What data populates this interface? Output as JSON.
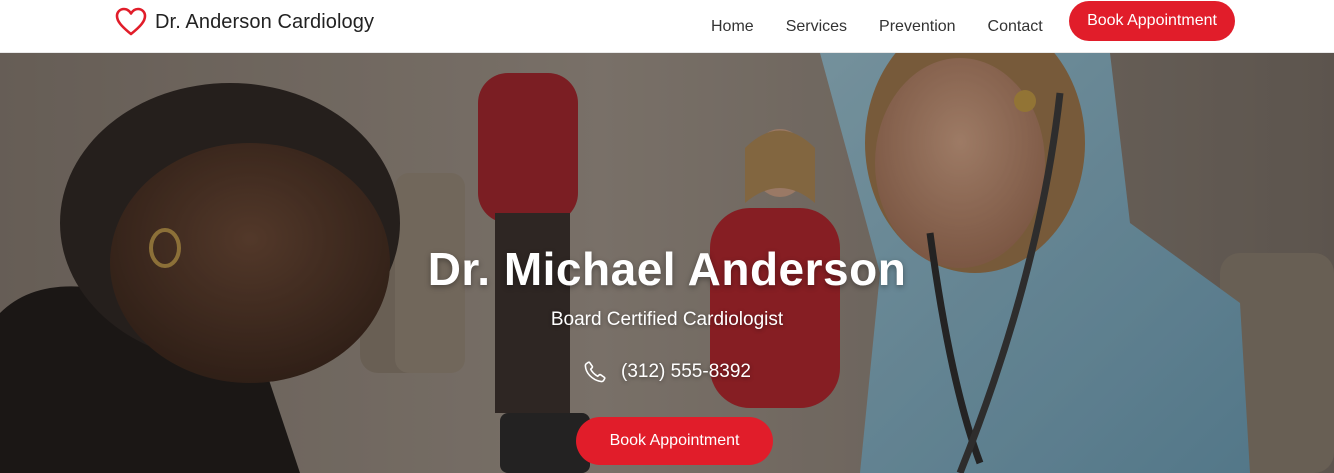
{
  "brand": {
    "name": "Dr. Anderson Cardiology",
    "icon": "heart-icon",
    "accent_color": "#e11d2a"
  },
  "nav": {
    "links": [
      "Home",
      "Services",
      "Prevention",
      "Contact"
    ],
    "cta_label": "Book Appointment"
  },
  "hero": {
    "title": "Dr. Michael Anderson",
    "subtitle": "Board Certified Cardiologist",
    "phone_icon": "phone-icon",
    "phone": "(312) 555-8392",
    "cta_label": "Book Appointment"
  }
}
